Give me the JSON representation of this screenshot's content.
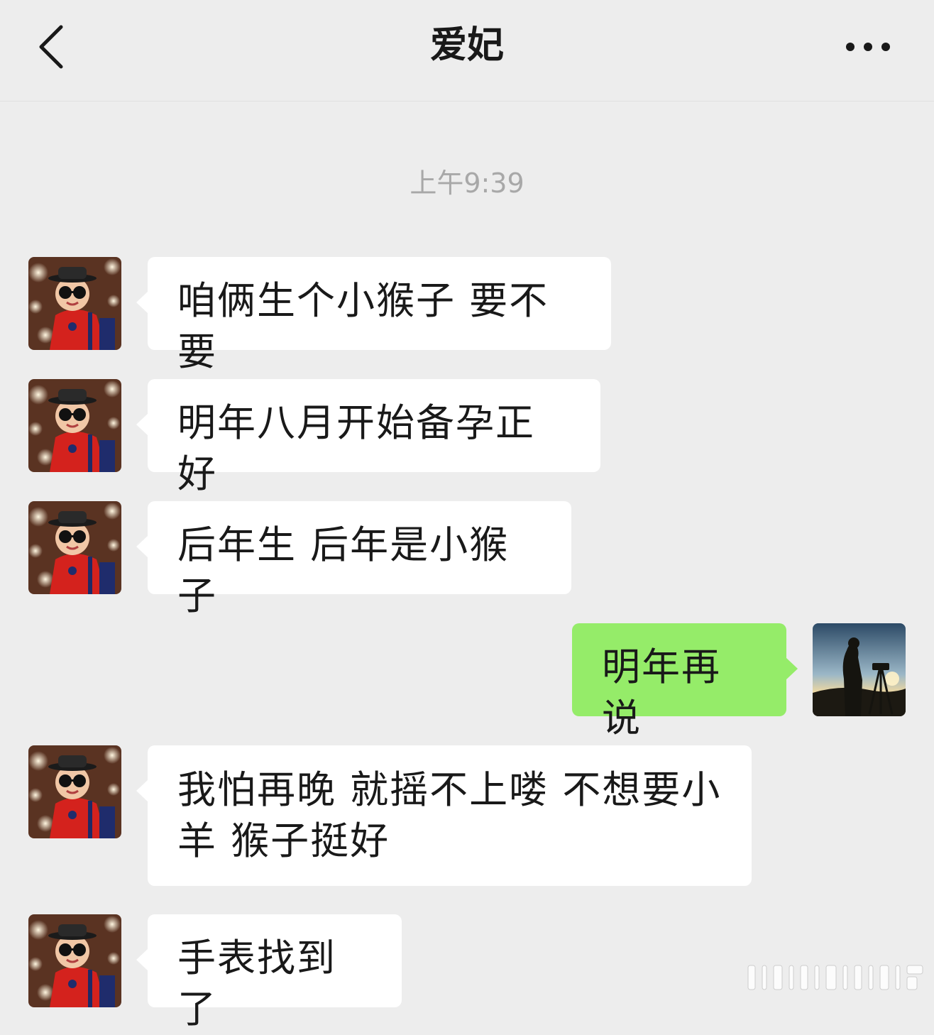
{
  "header": {
    "title": "爱妃",
    "back_icon": "chevron-left-icon",
    "more_icon": "more-horizontal-icon"
  },
  "chat": {
    "timestamp": "上午9:39",
    "messages": [
      {
        "sender": "contact",
        "text": "咱俩生个小猴子 要不要"
      },
      {
        "sender": "contact",
        "text": "明年八月开始备孕正好"
      },
      {
        "sender": "contact",
        "text": "后年生 后年是小猴子"
      },
      {
        "sender": "me",
        "text": "明年再说"
      },
      {
        "sender": "contact",
        "text": "我怕再晚 就摇不上喽  不想要小羊  猴子挺好"
      },
      {
        "sender": "contact",
        "text": "手表找到了"
      }
    ]
  },
  "colors": {
    "background": "#ededed",
    "incoming_bubble": "#ffffff",
    "outgoing_bubble": "#95ec69",
    "timestamp_text": "#a8a8a8",
    "text": "#191919"
  }
}
